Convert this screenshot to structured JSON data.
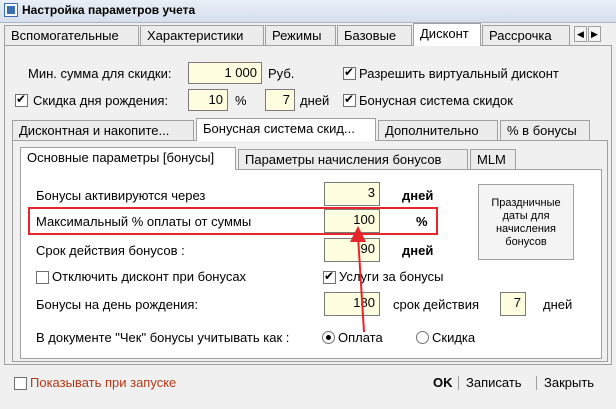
{
  "window": {
    "title": "Настройка параметров учета"
  },
  "top_tabs": [
    "Вспомогательные",
    "Характеристики",
    "Режимы",
    "Базовые",
    "Дисконт",
    "Рассрочка"
  ],
  "top_tab_active": "Дисконт",
  "discount": {
    "min_sum_label": "Мин. сумма для скидки:",
    "min_sum_value": "1 000",
    "currency": "Руб.",
    "allow_virtual_label": "Разрешить виртуальный дисконт",
    "birthday_discount_label": "Скидка дня рождения:",
    "birthday_percent_value": "10",
    "percent_sign": "%",
    "birthday_days_value": "7",
    "days_label": "дней",
    "bonus_system_label": "Бонусная система скидок"
  },
  "second_tabs": [
    "Дисконтная и накопите...",
    "Бонусная система скид...",
    "Дополнительно",
    "% в бонусы"
  ],
  "third_tabs": [
    "Основные параметры [бонусы]",
    "Параметры начисления бонусов",
    "MLM"
  ],
  "bonus": {
    "activate_label": "Бонусы активируются через",
    "activate_value": "3",
    "activate_unit": "дней",
    "max_percent_label": "Максимальный % оплаты от суммы",
    "max_percent_value": "100",
    "max_percent_unit": "%",
    "validity_label": "Срок действия бонусов :",
    "validity_value": "90",
    "validity_unit": "дней",
    "disable_discount_label": "Отключить дисконт при бонусах",
    "services_label": "Услуги за бонусы",
    "birthday_bonus_label": "Бонусы на день рождения:",
    "birthday_bonus_value": "180",
    "validity_period_label": "срок действия",
    "birthday_bonus_days_value": "7",
    "birthday_bonus_days_unit": "дней",
    "check_doc_label": "В документе \"Чек\" бонусы учитывать как :",
    "option_payment": "Оплата",
    "option_discount": "Скидка",
    "holiday_button": "Праздничные даты для начисления бонусов"
  },
  "footer": {
    "show_on_start": "Показывать при запуске",
    "ok": "OK",
    "save": "Записать",
    "close": "Закрыть"
  },
  "colors": {
    "highlight": "#e8252b",
    "input_bg": "#fffde0",
    "footer_text": "#b03a1a"
  },
  "icons": [
    "app-icon",
    "arrow-left-icon",
    "arrow-right-icon",
    "annotation-arrow-icon"
  ]
}
